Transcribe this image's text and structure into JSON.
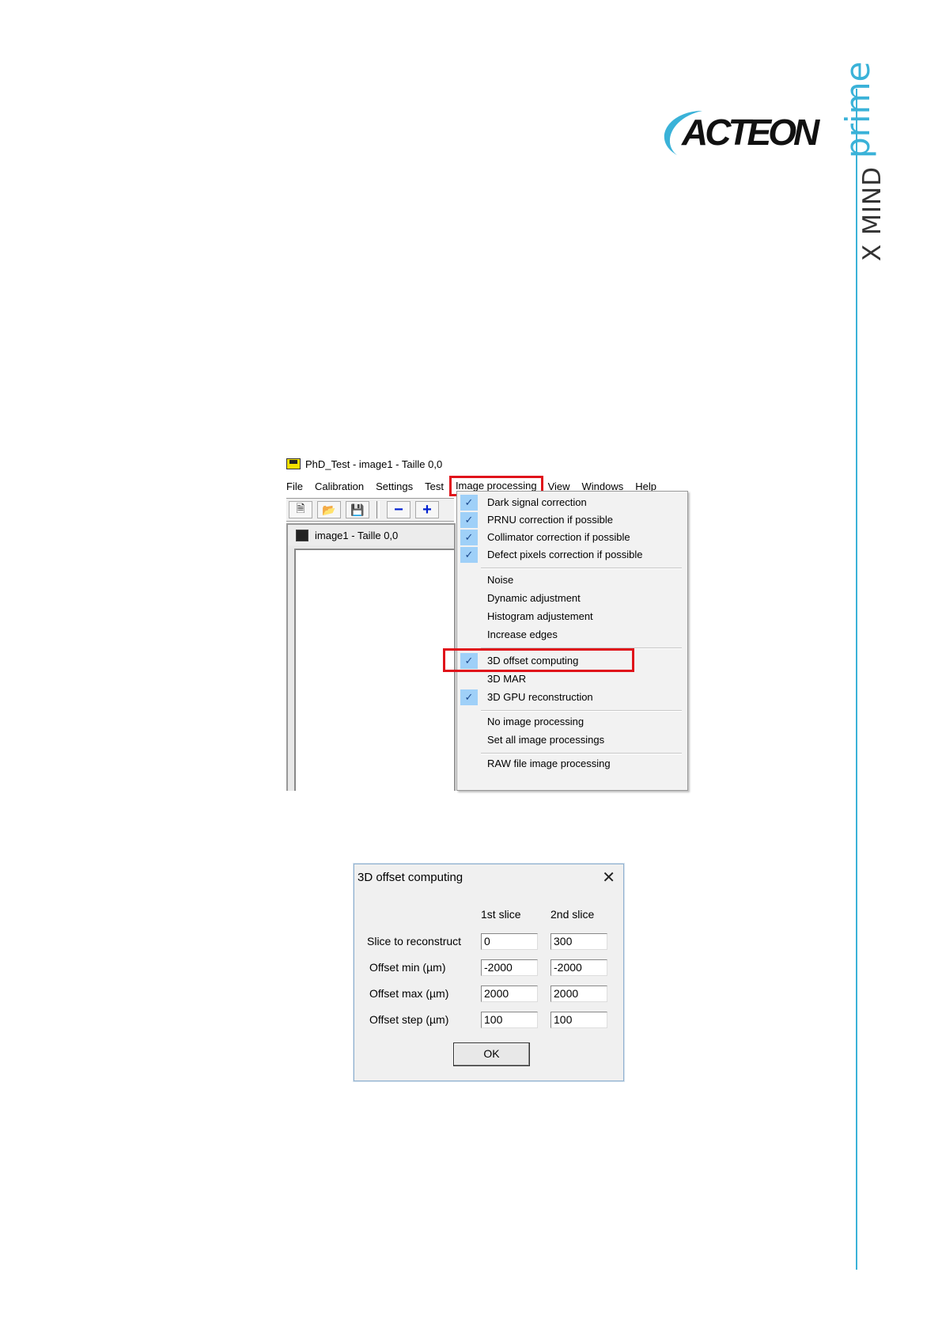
{
  "brand": {
    "logo_text": "ACTEON",
    "product_line1": "X MIND",
    "product_line2": "prime",
    "accent_color": "#3ab2d8"
  },
  "app_window": {
    "title": "PhD_Test - image1 - Taille 0,0",
    "menu": [
      "File",
      "Calibration",
      "Settings",
      "Test",
      "Image processing",
      "View",
      "Windows",
      "Help"
    ],
    "active_menu": "Image processing",
    "toolbar_icons": [
      "new-file-icon",
      "open-folder-icon",
      "save-icon",
      "minus-icon",
      "plus-icon"
    ],
    "child_window_title": "image1 - Taille 0,0",
    "dropdown_items": [
      {
        "label": "Dark signal correction",
        "checked": true
      },
      {
        "label": "PRNU correction if possible",
        "checked": true
      },
      {
        "label": "Collimator correction if possible",
        "checked": true
      },
      {
        "label": "Defect pixels correction if possible",
        "checked": true
      },
      {
        "label": "Noise",
        "checked": false
      },
      {
        "label": "Dynamic adjustment",
        "checked": false
      },
      {
        "label": "Histogram adjustement",
        "checked": false
      },
      {
        "label": "Increase edges",
        "checked": false
      },
      {
        "label": "3D offset computing",
        "checked": true,
        "highlighted": true
      },
      {
        "label": "3D MAR",
        "checked": false
      },
      {
        "label": "3D GPU reconstruction",
        "checked": true
      },
      {
        "label": "No image processing",
        "checked": false
      },
      {
        "label": "Set all image processings",
        "checked": false
      },
      {
        "label": "RAW file image processing",
        "checked": false
      }
    ]
  },
  "dialog": {
    "title": "3D offset computing",
    "col1": "1st slice",
    "col2": "2nd slice",
    "rows": [
      {
        "label": "Slice to reconstruct",
        "v1": "0",
        "v2": "300"
      },
      {
        "label": "Offset min (µm)",
        "v1": "-2000",
        "v2": "-2000"
      },
      {
        "label": "Offset max (µm)",
        "v1": "2000",
        "v2": "2000"
      },
      {
        "label": "Offset step (µm)",
        "v1": "100",
        "v2": "100"
      }
    ],
    "ok_label": "OK"
  }
}
